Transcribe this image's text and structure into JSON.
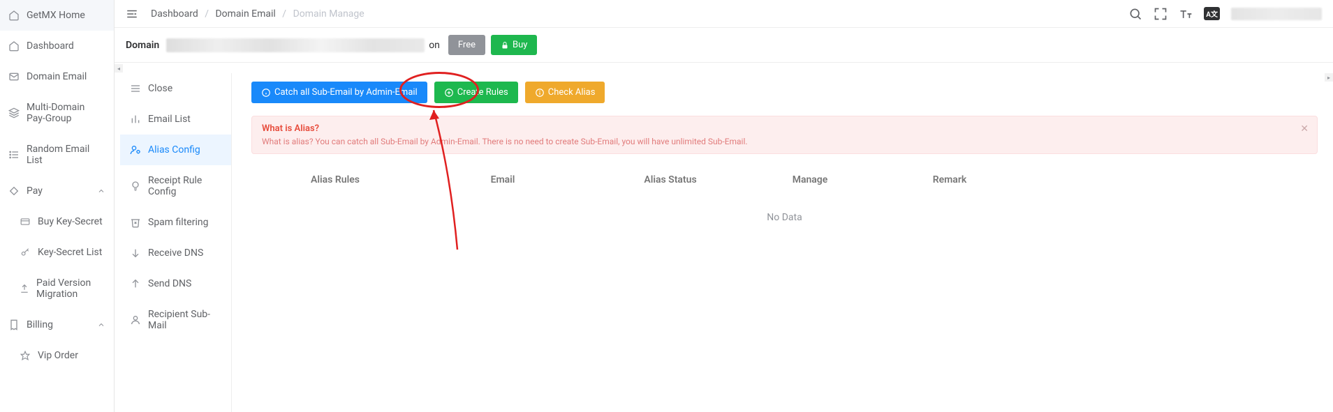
{
  "sidebar": {
    "home": "GetMX Home",
    "dashboard": "Dashboard",
    "domain_email": "Domain Email",
    "multi_domain": "Multi-Domain Pay-Group",
    "random_email": "Random Email List",
    "pay": "Pay",
    "buy_key": "Buy Key-Secret",
    "key_list": "Key-Secret List",
    "paid_migration": "Paid Version Migration",
    "billing": "Billing",
    "vip_order": "Vip Order"
  },
  "breadcrumb": {
    "a": "Dashboard",
    "b": "Domain Email",
    "c": "Domain Manage"
  },
  "domainbar": {
    "label": "Domain",
    "suffix": "on",
    "free": "Free",
    "buy": "Buy"
  },
  "subnav": {
    "close": "Close",
    "email_list": "Email List",
    "alias_config": "Alias Config",
    "receipt_rule": "Receipt Rule Config",
    "spam": "Spam filtering",
    "receive_dns": "Receive DNS",
    "send_dns": "Send DNS",
    "recipient": "Recipient Sub-Mail"
  },
  "actions": {
    "catch_all": "Catch all Sub-Email by Admin-Email",
    "create_rules": "Create Rules",
    "check_alias": "Check Alias"
  },
  "alert": {
    "title": "What is Alias?",
    "body": "What is alias? You can catch all Sub-Email by Admin-Email. There is no need to create Sub-Email, you will have unlimited Sub-Email."
  },
  "table": {
    "headers": {
      "rules": "Alias Rules",
      "email": "Email",
      "status": "Alias Status",
      "manage": "Manage",
      "remark": "Remark"
    },
    "nodata": "No Data"
  },
  "lang": "A文"
}
